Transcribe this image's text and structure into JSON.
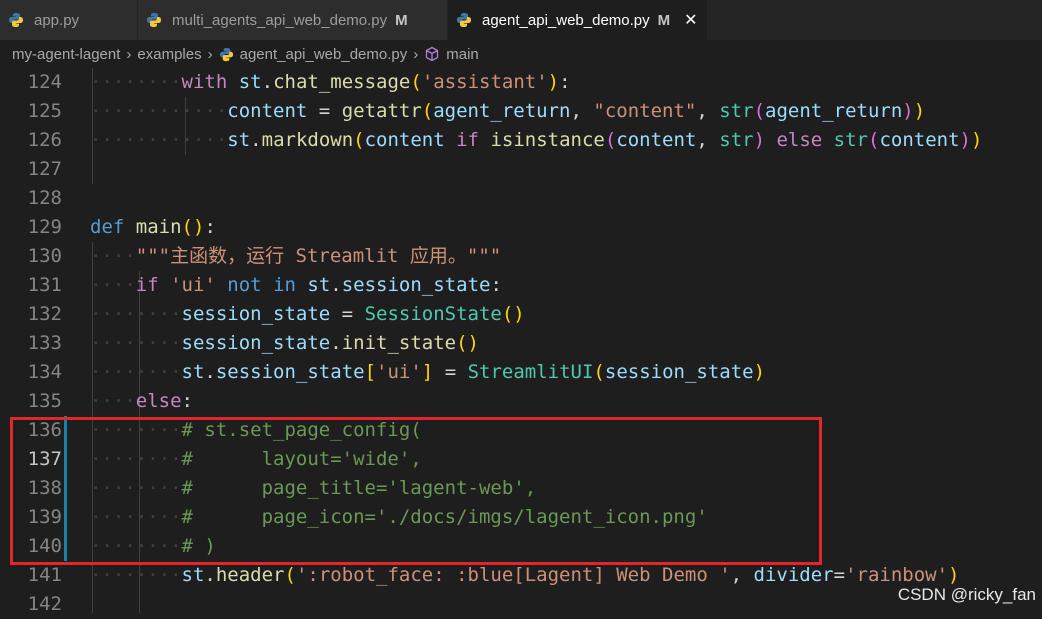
{
  "tabs": [
    {
      "label": "app.py",
      "modified": "",
      "active": false
    },
    {
      "label": "multi_agents_api_web_demo.py",
      "modified": "M",
      "active": false
    },
    {
      "label": "agent_api_web_demo.py",
      "modified": "M",
      "active": true
    }
  ],
  "close_glyph": "✕",
  "breadcrumb": {
    "items": [
      "my-agent-lagent",
      "examples",
      "agent_api_web_demo.py",
      "main"
    ],
    "separator": "›"
  },
  "line_numbers": [
    "124",
    "125",
    "126",
    "127",
    "128",
    "129",
    "130",
    "131",
    "132",
    "133",
    "134",
    "135",
    "136",
    "137",
    "138",
    "139",
    "140",
    "141",
    "142"
  ],
  "current_line": "137",
  "code": {
    "l124": {
      "with": "with",
      "st": "st",
      "dot": ".",
      "fn": "chat_message",
      "po": "(",
      "str": "'assistant'",
      "pc": ")",
      "colon": ":"
    },
    "l125": {
      "content": "content",
      "eq": " = ",
      "fn": "getattr",
      "po": "(",
      "arg": "agent_return",
      "comma": ", ",
      "str": "\"content\"",
      "comma2": ", ",
      "cls": "str",
      "po2": "(",
      "arg2": "agent_return",
      "pc2": ")",
      "pc": ")"
    },
    "l126": {
      "st": "st",
      "dot": ".",
      "fn": "markdown",
      "po": "(",
      "content": "content",
      "if": " if ",
      "fn2": "isinstance",
      "po2": "(",
      "content2": "content",
      "comma": ", ",
      "cls": "str",
      "pc2": ")",
      "else": " else ",
      "cls2": "str",
      "po3": "(",
      "content3": "content",
      "pc3": ")",
      "pc": ")"
    },
    "l129": {
      "def": "def",
      "fn": " main",
      "po": "(",
      "pc": ")",
      "colon": ":"
    },
    "l130": {
      "doc": "\"\"\"主函数，运行 Streamlit 应用。\"\"\""
    },
    "l131": {
      "if": "if",
      "str": " 'ui'",
      "not": " not",
      "in": " in",
      "st": " st",
      "dot": ".",
      "attr": "session_state",
      "colon": ":"
    },
    "l132": {
      "var": "session_state",
      "eq": " = ",
      "cls": "SessionState",
      "po": "(",
      "pc": ")"
    },
    "l133": {
      "var": "session_state",
      "dot": ".",
      "fn": "init_state",
      "po": "(",
      "pc": ")"
    },
    "l134": {
      "st": "st",
      "dot": ".",
      "attr": "session_state",
      "bo": "[",
      "str": "'ui'",
      "bc": "]",
      "eq": " = ",
      "cls": "StreamlitUI",
      "po": "(",
      "arg": "session_state",
      "pc": ")"
    },
    "l135": {
      "else": "else",
      "colon": ":"
    },
    "l136": {
      "cmt": "# st.set_page_config("
    },
    "l137": {
      "hash": "#",
      "rest": "      layout='wide',"
    },
    "l138": {
      "hash": "#",
      "rest": "      page_title='lagent-web',"
    },
    "l139": {
      "hash": "#",
      "rest": "      page_icon='./docs/imgs/lagent_icon.png'"
    },
    "l140": {
      "cmt": "# )"
    },
    "l141": {
      "st": "st",
      "dot": ".",
      "fn": "header",
      "po": "(",
      "str": "':robot_face: :blue[Lagent] Web Demo '",
      "comma": ", ",
      "kwarg": "divider",
      "eq": "=",
      "str2": "'rainbow'",
      "pc": ")"
    }
  },
  "watermark": "CSDN @ricky_fan",
  "colors": {
    "highlight_box": "#e3262b",
    "modified_gutter": "#1b81a8",
    "background": "#1e1e1e"
  }
}
